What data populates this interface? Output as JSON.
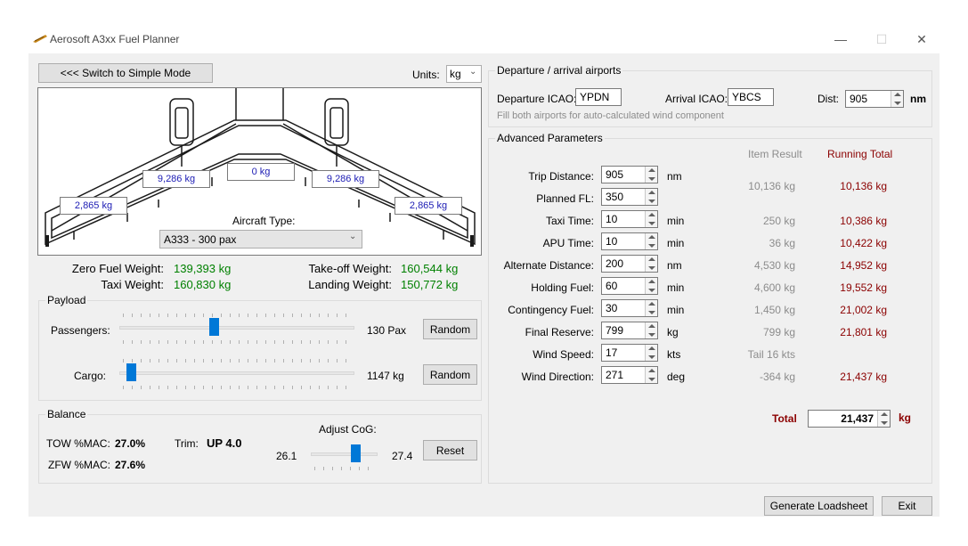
{
  "window": {
    "title": "Aerosoft A3xx Fuel Planner"
  },
  "topbar": {
    "switch_label": "<<< Switch to Simple Mode",
    "units_label": "Units:",
    "units_value": "kg"
  },
  "aircraft": {
    "tank_left_outer": "2,865 kg",
    "tank_left_inner": "9,286 kg",
    "tank_center": "0 kg",
    "tank_right_inner": "9,286 kg",
    "tank_right_outer": "2,865 kg",
    "type_label": "Aircraft Type:",
    "type_value": "A333 - 300 pax"
  },
  "weights": {
    "zfw_label": "Zero Fuel Weight:",
    "zfw_value": "139,393 kg",
    "taxi_label": "Taxi Weight:",
    "taxi_value": "160,830 kg",
    "tow_label": "Take-off Weight:",
    "tow_value": "160,544 kg",
    "lw_label": "Landing Weight:",
    "lw_value": "150,772 kg"
  },
  "payload": {
    "title": "Payload",
    "passengers_label": "Passengers:",
    "passengers_value": "130 Pax",
    "passengers_level": 0.4,
    "cargo_label": "Cargo:",
    "cargo_value": "1147 kg",
    "cargo_level": 0.03,
    "random_label": "Random"
  },
  "balance": {
    "title": "Balance",
    "tow_mac_label": "TOW %MAC:",
    "tow_mac_value": "27.0%",
    "zfw_mac_label": "ZFW %MAC:",
    "zfw_mac_value": "27.6%",
    "trim_label": "Trim:",
    "trim_value": "UP 4.0",
    "cog_label": "Adjust CoG:",
    "cog_min": "26.1",
    "cog_max": "27.4",
    "cog_level": 0.7,
    "reset_label": "Reset"
  },
  "airports": {
    "title": "Departure / arrival airports",
    "dep_label": "Departure ICAO:",
    "dep_value": "YPDN",
    "arr_label": "Arrival ICAO:",
    "arr_value": "YBCS",
    "dist_label": "Dist:",
    "dist_value": "905",
    "dist_unit": "nm",
    "hint": "Fill both airports for auto-calculated wind component"
  },
  "advanced": {
    "title": "Advanced Parameters",
    "item_result_header": "Item Result",
    "running_total_header": "Running Total",
    "rows": [
      {
        "label": "Trip Distance:",
        "value": "905",
        "unit": "nm"
      },
      {
        "label": "Planned FL:",
        "value": "350",
        "unit": ""
      },
      {
        "label": "Taxi Time:",
        "value": "10",
        "unit": "min",
        "result": "250 kg",
        "total": "10,386 kg"
      },
      {
        "label": "APU Time:",
        "value": "10",
        "unit": "min",
        "result": "36 kg",
        "total": "10,422 kg"
      },
      {
        "label": "Alternate Distance:",
        "value": "200",
        "unit": "nm",
        "result": "4,530 kg",
        "total": "14,952 kg"
      },
      {
        "label": "Holding Fuel:",
        "value": "60",
        "unit": "min",
        "result": "4,600 kg",
        "total": "19,552 kg"
      },
      {
        "label": "Contingency Fuel:",
        "value": "30",
        "unit": "min",
        "result": "1,450 kg",
        "total": "21,002 kg"
      },
      {
        "label": "Final Reserve:",
        "value": "799",
        "unit": "kg",
        "result": "799 kg",
        "total": "21,801 kg"
      },
      {
        "label": "Wind Speed:",
        "value": "17",
        "unit": "kts",
        "result": "Tail 16 kts",
        "total": ""
      },
      {
        "label": "Wind Direction:",
        "value": "271",
        "unit": "deg",
        "result": "-364 kg",
        "total": "21,437 kg"
      }
    ],
    "trip_result": "10,136 kg",
    "trip_total": "10,136 kg",
    "total_label": "Total",
    "total_value": "21,437",
    "total_unit": "kg"
  },
  "footer": {
    "generate_label": "Generate Loadsheet",
    "exit_label": "Exit"
  }
}
